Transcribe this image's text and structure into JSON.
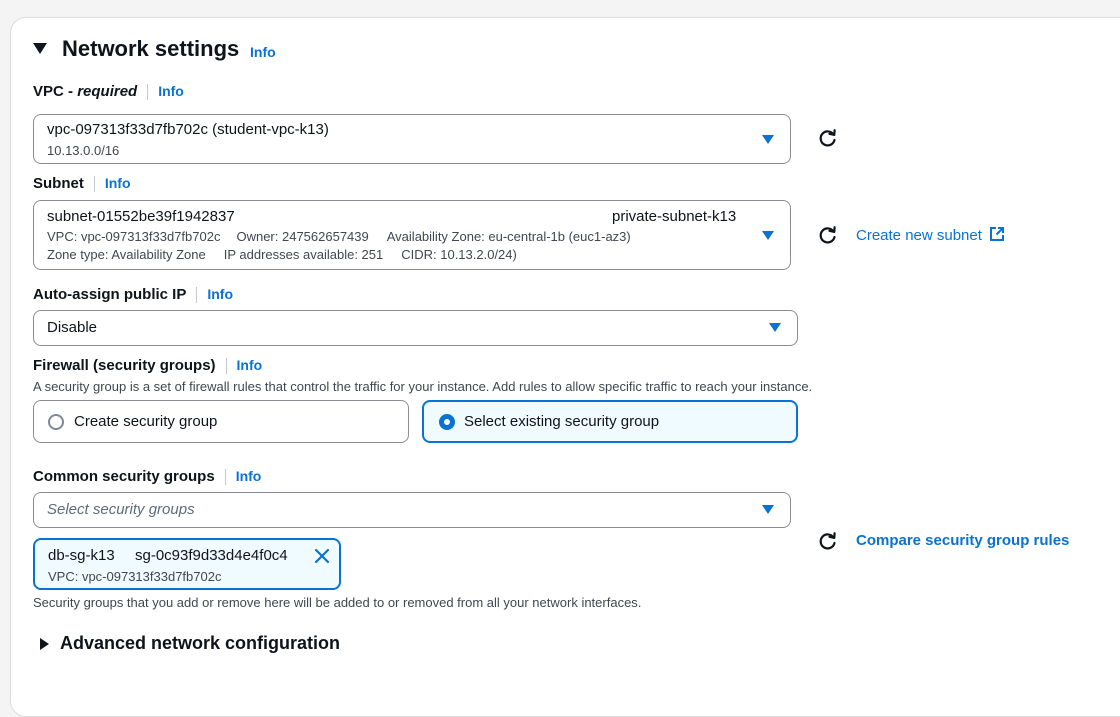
{
  "section": {
    "title": "Network settings",
    "info": "Info"
  },
  "vpc": {
    "label": "VPC - ",
    "label_required": "required",
    "info": "Info",
    "value": "vpc-097313f33d7fb702c (student-vpc-k13)",
    "cidr": "10.13.0.0/16"
  },
  "subnet": {
    "label": "Subnet",
    "info": "Info",
    "id": "subnet-01552be39f1942837",
    "name": "private-subnet-k13",
    "vpc": "VPC: vpc-097313f33d7fb702c",
    "owner": "Owner: 247562657439",
    "az": "Availability Zone: eu-central-1b (euc1-az3)",
    "zone_type": "Zone type: Availability Zone",
    "ips": "IP addresses available: 251",
    "cidr": "CIDR: 10.13.2.0/24)",
    "create_link": "Create new subnet"
  },
  "auto_assign": {
    "label": "Auto-assign public IP",
    "info": "Info",
    "value": "Disable"
  },
  "firewall": {
    "label": "Firewall (security groups)",
    "info": "Info",
    "description": "A security group is a set of firewall rules that control the traffic for your instance. Add rules to allow specific traffic to reach your instance.",
    "option_create": "Create security group",
    "option_existing": "Select existing security group",
    "selected": "Select existing security group"
  },
  "common_sg": {
    "label": "Common security groups",
    "info": "Info",
    "placeholder": "Select security groups",
    "token_name": "db-sg-k13",
    "token_id": "sg-0c93f9d33d4e4f0c4",
    "token_vpc": "VPC: vpc-097313f33d7fb702c",
    "compare_link": "Compare security group rules",
    "help": "Security groups that you add or remove here will be added to or removed from all your network interfaces."
  },
  "advanced": {
    "title": "Advanced network configuration"
  },
  "colors": {
    "accent": "#0972d3",
    "selected_bg": "#f0fbff"
  }
}
